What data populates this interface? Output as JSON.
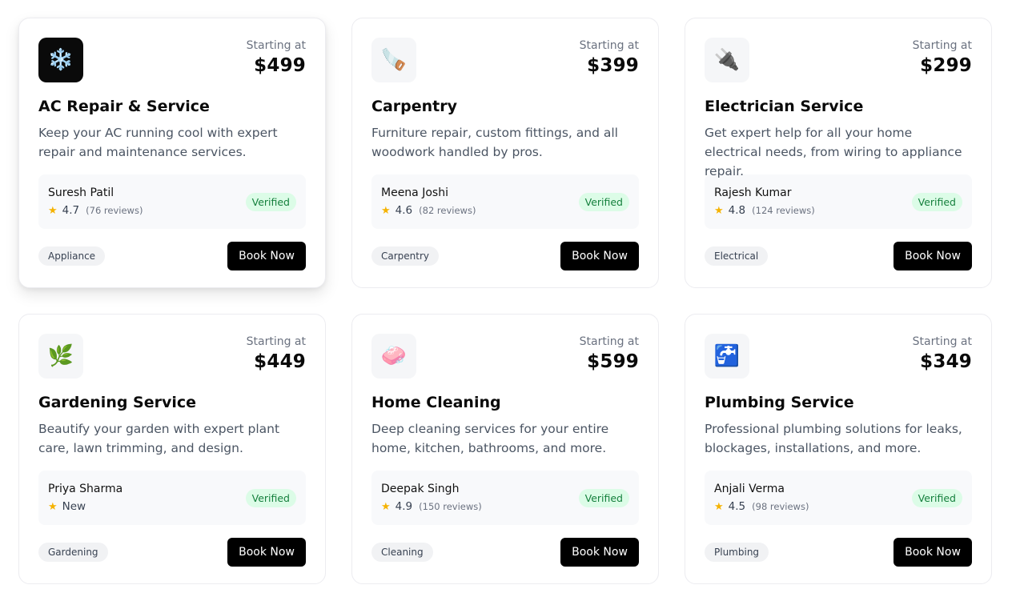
{
  "price_label": "Starting at",
  "verified_label": "Verified",
  "book_label": "Book Now",
  "colors": {
    "accent": "#000000",
    "verified_bg": "#dcfce7",
    "verified_text": "#15803d",
    "star": "#f5b301"
  },
  "services": [
    {
      "icon": "snowflake-icon",
      "glyph": "❄️",
      "dark_icon": true,
      "price": "$499",
      "title": "AC Repair & Service",
      "description": "Keep your AC running cool with expert repair and maintenance services.",
      "provider": "Suresh Patil",
      "rating": "4.7",
      "reviews": "(76 reviews)",
      "category": "Appliance"
    },
    {
      "icon": "saw-icon",
      "glyph": "🪚",
      "dark_icon": false,
      "price": "$399",
      "title": "Carpentry",
      "description": "Furniture repair, custom fittings, and all woodwork handled by pros.",
      "provider": "Meena Joshi",
      "rating": "4.6",
      "reviews": "(82 reviews)",
      "category": "Carpentry"
    },
    {
      "icon": "electric-plug-icon",
      "glyph": "🔌",
      "dark_icon": false,
      "price": "$299",
      "title": "Electrician Service",
      "description": "Get expert help for all your home electrical needs, from wiring to appliance repair.",
      "provider": "Rajesh Kumar",
      "rating": "4.8",
      "reviews": "(124 reviews)",
      "category": "Electrical"
    },
    {
      "icon": "herb-icon",
      "glyph": "🌿",
      "dark_icon": false,
      "price": "$449",
      "title": "Gardening Service",
      "description": "Beautify your garden with expert plant care, lawn trimming, and design.",
      "provider": "Priya Sharma",
      "rating": "New",
      "reviews": "",
      "category": "Gardening"
    },
    {
      "icon": "soap-icon",
      "glyph": "🧼",
      "dark_icon": false,
      "price": "$599",
      "title": "Home Cleaning",
      "description": "Deep cleaning services for your entire home, kitchen, bathrooms, and more.",
      "provider": "Deepak Singh",
      "rating": "4.9",
      "reviews": "(150 reviews)",
      "category": "Cleaning"
    },
    {
      "icon": "potable-water-icon",
      "glyph": "🚰",
      "dark_icon": false,
      "price": "$349",
      "title": "Plumbing Service",
      "description": "Professional plumbing solutions for leaks, blockages, installations, and more.",
      "provider": "Anjali Verma",
      "rating": "4.5",
      "reviews": "(98 reviews)",
      "category": "Plumbing"
    }
  ]
}
